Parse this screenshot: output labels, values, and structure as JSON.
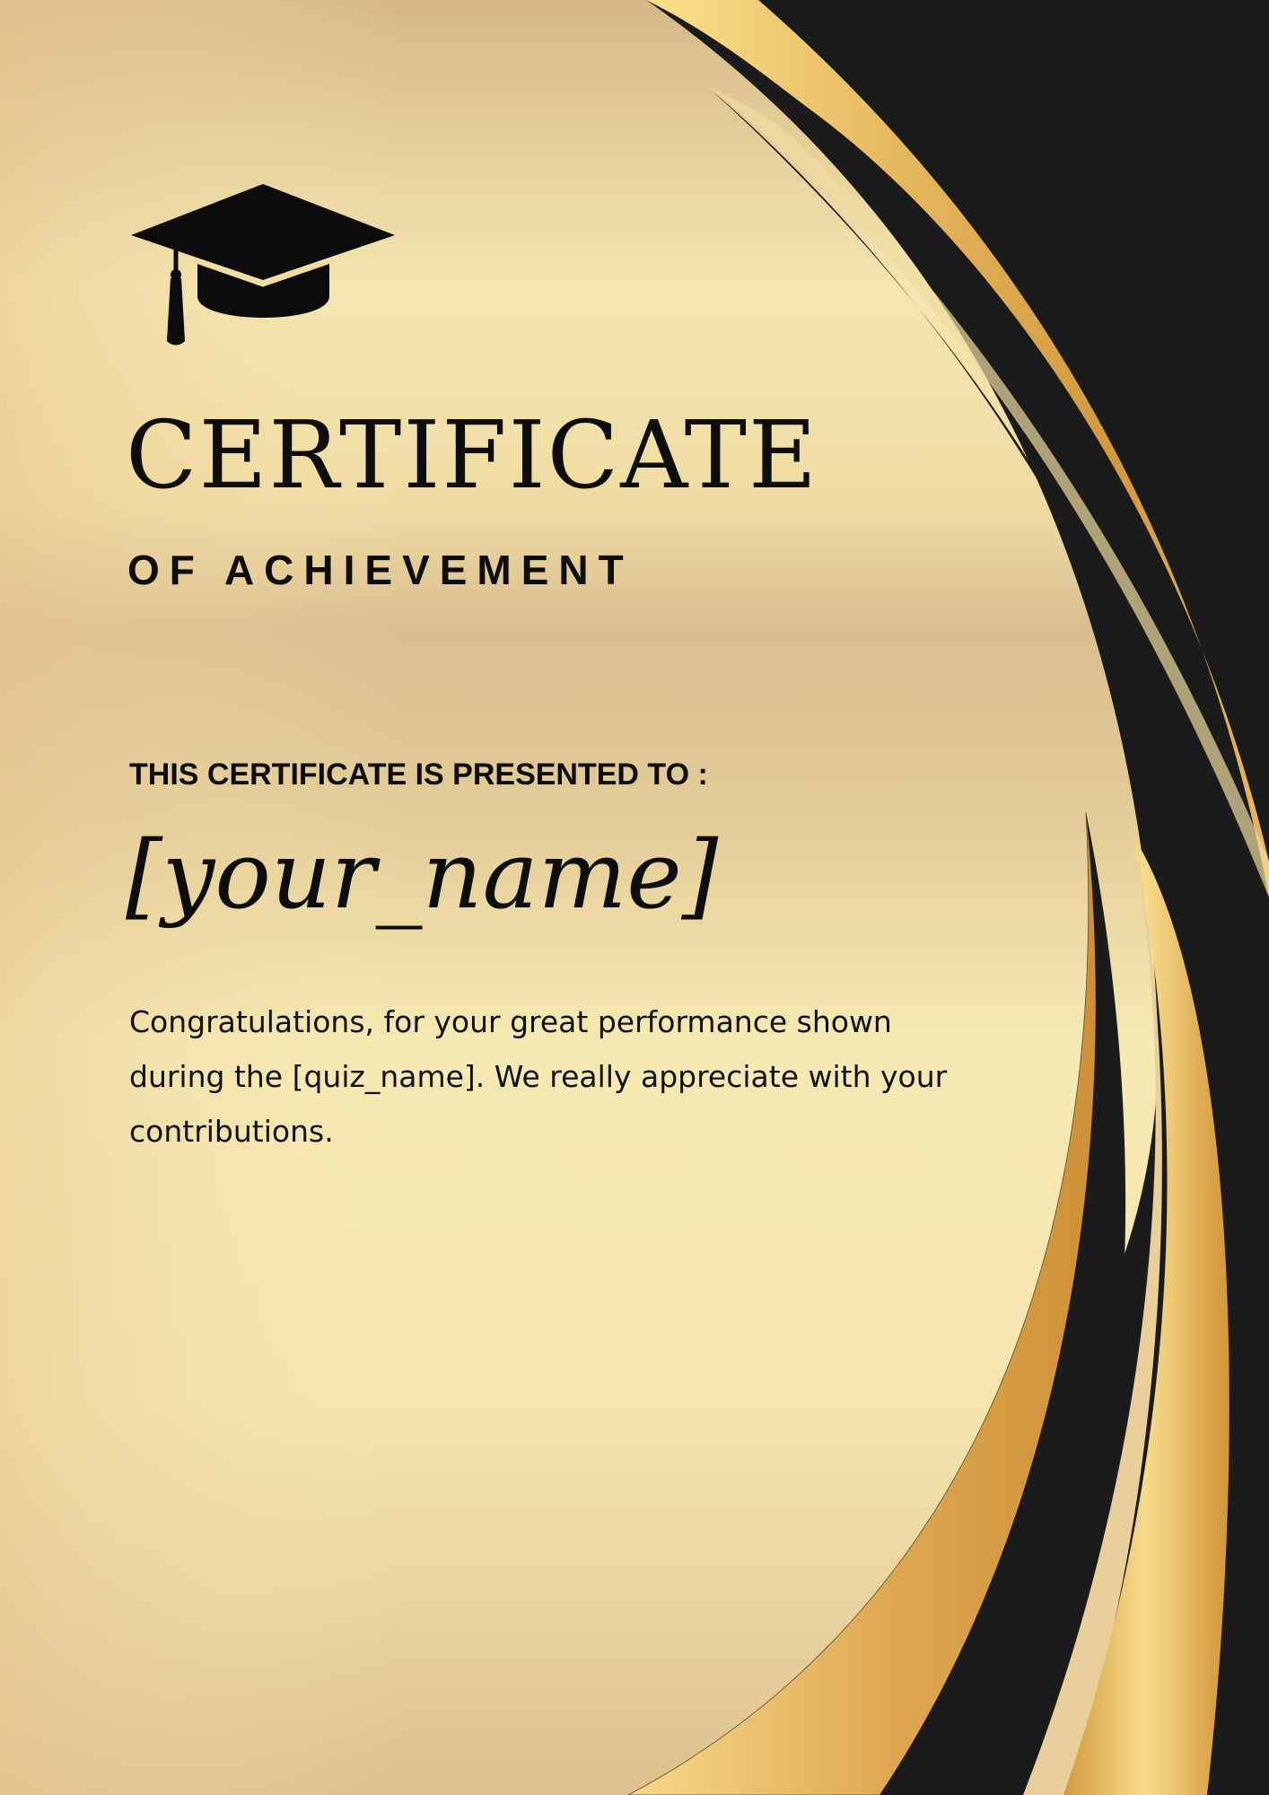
{
  "certificate": {
    "title": "CERTIFICATE",
    "subtitle": "OF ACHIEVEMENT",
    "presented_to": "THIS CERTIFICATE IS PRESENTED TO :",
    "recipient_name": "[your_name]",
    "message": "Congratulations, for your great performance shown during the [quiz_name]. We really appreciate with your contributions."
  },
  "icons": {
    "emblem": "graduation-cap-icon"
  },
  "colors": {
    "gold_light": "#f8ebb0",
    "gold_mid": "#dcc08e",
    "gold_dark": "#d29538",
    "black": "#1b1b1b",
    "text": "#0d0d0d"
  }
}
